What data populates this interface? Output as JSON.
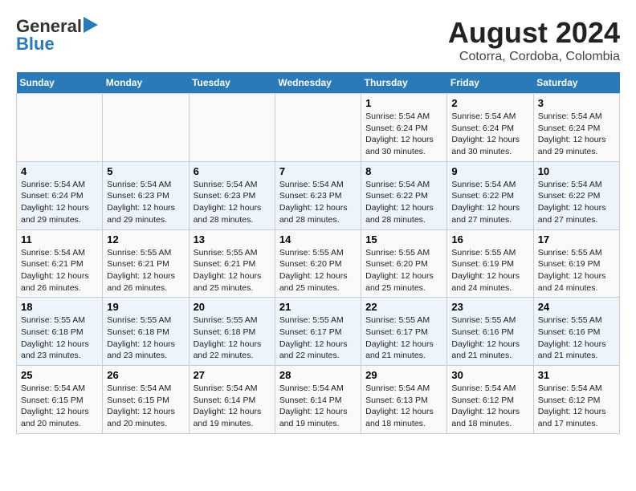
{
  "logo": {
    "line1": "General",
    "line2": "Blue"
  },
  "title": "August 2024",
  "subtitle": "Cotorra, Cordoba, Colombia",
  "weekdays": [
    "Sunday",
    "Monday",
    "Tuesday",
    "Wednesday",
    "Thursday",
    "Friday",
    "Saturday"
  ],
  "weeks": [
    [
      {
        "day": "",
        "info": ""
      },
      {
        "day": "",
        "info": ""
      },
      {
        "day": "",
        "info": ""
      },
      {
        "day": "",
        "info": ""
      },
      {
        "day": "1",
        "info": "Sunrise: 5:54 AM\nSunset: 6:24 PM\nDaylight: 12 hours and 30 minutes."
      },
      {
        "day": "2",
        "info": "Sunrise: 5:54 AM\nSunset: 6:24 PM\nDaylight: 12 hours and 30 minutes."
      },
      {
        "day": "3",
        "info": "Sunrise: 5:54 AM\nSunset: 6:24 PM\nDaylight: 12 hours and 29 minutes."
      }
    ],
    [
      {
        "day": "4",
        "info": "Sunrise: 5:54 AM\nSunset: 6:24 PM\nDaylight: 12 hours and 29 minutes."
      },
      {
        "day": "5",
        "info": "Sunrise: 5:54 AM\nSunset: 6:23 PM\nDaylight: 12 hours and 29 minutes."
      },
      {
        "day": "6",
        "info": "Sunrise: 5:54 AM\nSunset: 6:23 PM\nDaylight: 12 hours and 28 minutes."
      },
      {
        "day": "7",
        "info": "Sunrise: 5:54 AM\nSunset: 6:23 PM\nDaylight: 12 hours and 28 minutes."
      },
      {
        "day": "8",
        "info": "Sunrise: 5:54 AM\nSunset: 6:22 PM\nDaylight: 12 hours and 28 minutes."
      },
      {
        "day": "9",
        "info": "Sunrise: 5:54 AM\nSunset: 6:22 PM\nDaylight: 12 hours and 27 minutes."
      },
      {
        "day": "10",
        "info": "Sunrise: 5:54 AM\nSunset: 6:22 PM\nDaylight: 12 hours and 27 minutes."
      }
    ],
    [
      {
        "day": "11",
        "info": "Sunrise: 5:54 AM\nSunset: 6:21 PM\nDaylight: 12 hours and 26 minutes."
      },
      {
        "day": "12",
        "info": "Sunrise: 5:55 AM\nSunset: 6:21 PM\nDaylight: 12 hours and 26 minutes."
      },
      {
        "day": "13",
        "info": "Sunrise: 5:55 AM\nSunset: 6:21 PM\nDaylight: 12 hours and 25 minutes."
      },
      {
        "day": "14",
        "info": "Sunrise: 5:55 AM\nSunset: 6:20 PM\nDaylight: 12 hours and 25 minutes."
      },
      {
        "day": "15",
        "info": "Sunrise: 5:55 AM\nSunset: 6:20 PM\nDaylight: 12 hours and 25 minutes."
      },
      {
        "day": "16",
        "info": "Sunrise: 5:55 AM\nSunset: 6:19 PM\nDaylight: 12 hours and 24 minutes."
      },
      {
        "day": "17",
        "info": "Sunrise: 5:55 AM\nSunset: 6:19 PM\nDaylight: 12 hours and 24 minutes."
      }
    ],
    [
      {
        "day": "18",
        "info": "Sunrise: 5:55 AM\nSunset: 6:18 PM\nDaylight: 12 hours and 23 minutes."
      },
      {
        "day": "19",
        "info": "Sunrise: 5:55 AM\nSunset: 6:18 PM\nDaylight: 12 hours and 23 minutes."
      },
      {
        "day": "20",
        "info": "Sunrise: 5:55 AM\nSunset: 6:18 PM\nDaylight: 12 hours and 22 minutes."
      },
      {
        "day": "21",
        "info": "Sunrise: 5:55 AM\nSunset: 6:17 PM\nDaylight: 12 hours and 22 minutes."
      },
      {
        "day": "22",
        "info": "Sunrise: 5:55 AM\nSunset: 6:17 PM\nDaylight: 12 hours and 21 minutes."
      },
      {
        "day": "23",
        "info": "Sunrise: 5:55 AM\nSunset: 6:16 PM\nDaylight: 12 hours and 21 minutes."
      },
      {
        "day": "24",
        "info": "Sunrise: 5:55 AM\nSunset: 6:16 PM\nDaylight: 12 hours and 21 minutes."
      }
    ],
    [
      {
        "day": "25",
        "info": "Sunrise: 5:54 AM\nSunset: 6:15 PM\nDaylight: 12 hours and 20 minutes."
      },
      {
        "day": "26",
        "info": "Sunrise: 5:54 AM\nSunset: 6:15 PM\nDaylight: 12 hours and 20 minutes."
      },
      {
        "day": "27",
        "info": "Sunrise: 5:54 AM\nSunset: 6:14 PM\nDaylight: 12 hours and 19 minutes."
      },
      {
        "day": "28",
        "info": "Sunrise: 5:54 AM\nSunset: 6:14 PM\nDaylight: 12 hours and 19 minutes."
      },
      {
        "day": "29",
        "info": "Sunrise: 5:54 AM\nSunset: 6:13 PM\nDaylight: 12 hours and 18 minutes."
      },
      {
        "day": "30",
        "info": "Sunrise: 5:54 AM\nSunset: 6:12 PM\nDaylight: 12 hours and 18 minutes."
      },
      {
        "day": "31",
        "info": "Sunrise: 5:54 AM\nSunset: 6:12 PM\nDaylight: 12 hours and 17 minutes."
      }
    ]
  ]
}
